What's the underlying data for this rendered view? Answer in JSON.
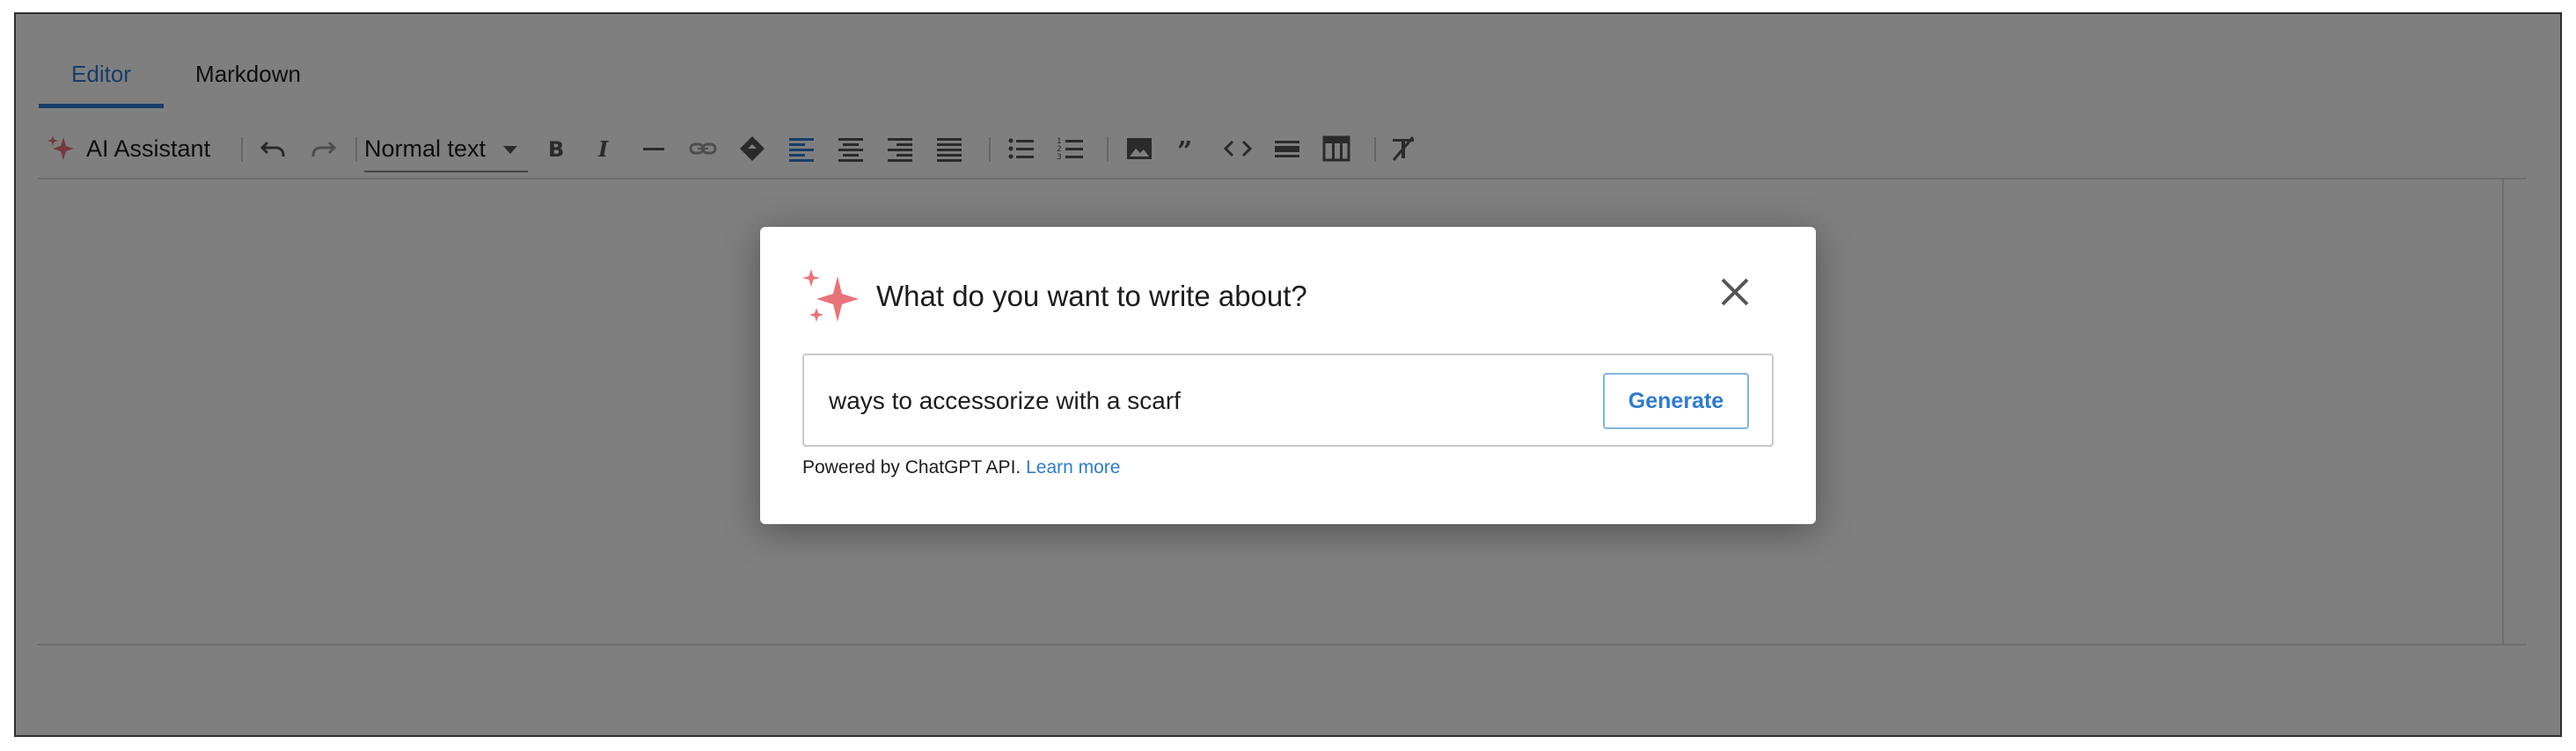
{
  "tabs": [
    {
      "label": "Editor",
      "active": true
    },
    {
      "label": "Markdown",
      "active": false
    }
  ],
  "toolbar": {
    "ai_assistant_label": "AI Assistant",
    "text_style": "Normal text",
    "icons": [
      "undo-icon",
      "redo-icon",
      "bold-icon",
      "italic-icon",
      "horizontal-line-icon",
      "link-icon",
      "paint-fill-icon",
      "align-left-icon",
      "align-center-icon",
      "align-right-icon",
      "align-justify-icon",
      "bullet-list-icon",
      "numbered-list-icon",
      "image-icon",
      "quote-icon",
      "code-icon",
      "divider-icon",
      "table-icon",
      "clear-format-icon"
    ]
  },
  "modal": {
    "title": "What do you want to write about?",
    "input_value": "ways to accessorize with a scarf",
    "generate_label": "Generate",
    "powered_text": "Powered by ChatGPT API.",
    "learn_more": "Learn more"
  },
  "colors": {
    "accent": "#2e7bcf",
    "sparkle": "#e8747a",
    "overlay": "rgba(0,0,0,0.5)"
  }
}
